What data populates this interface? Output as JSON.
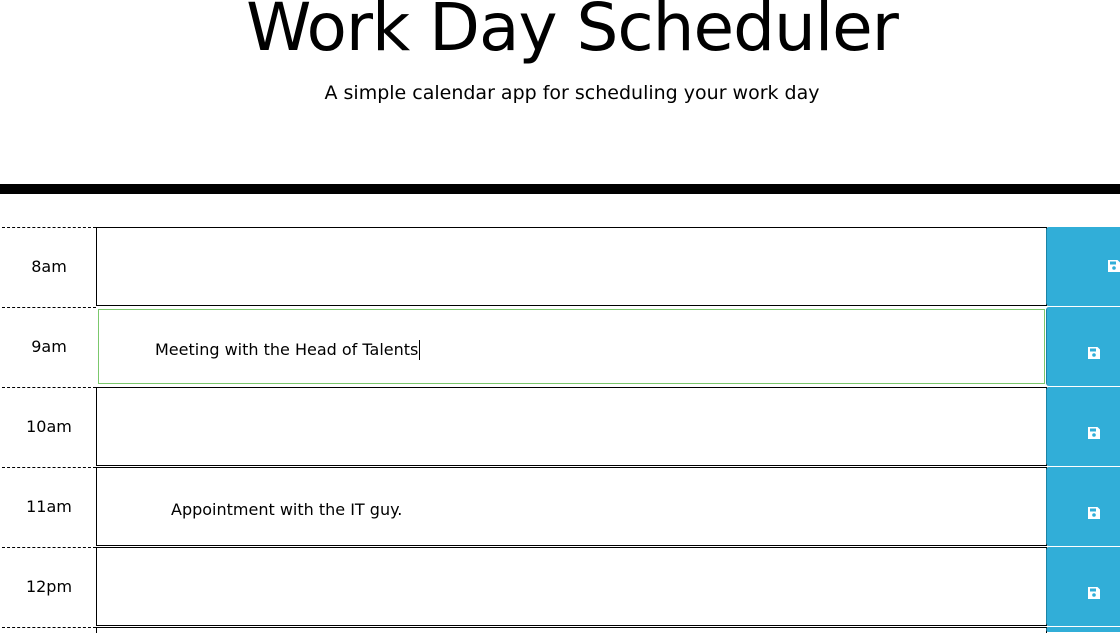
{
  "header": {
    "title": "Work Day Scheduler",
    "subtitle": "A simple calendar app for scheduling your work day"
  },
  "time_blocks": [
    {
      "hour": "8am",
      "text": "",
      "state": "idle"
    },
    {
      "hour": "9am",
      "text": "Meeting with the Head of Talents",
      "state": "focused"
    },
    {
      "hour": "10am",
      "text": "",
      "state": "idle"
    },
    {
      "hour": "11am",
      "text": "Appointment with the IT guy.",
      "state": "idle"
    },
    {
      "hour": "12pm",
      "text": "",
      "state": "idle"
    }
  ],
  "icons": {
    "save": "floppy-disk-icon"
  },
  "colors": {
    "save_button": "#31aed8",
    "focus_outline": "#7bc86c",
    "divider": "#000000"
  }
}
